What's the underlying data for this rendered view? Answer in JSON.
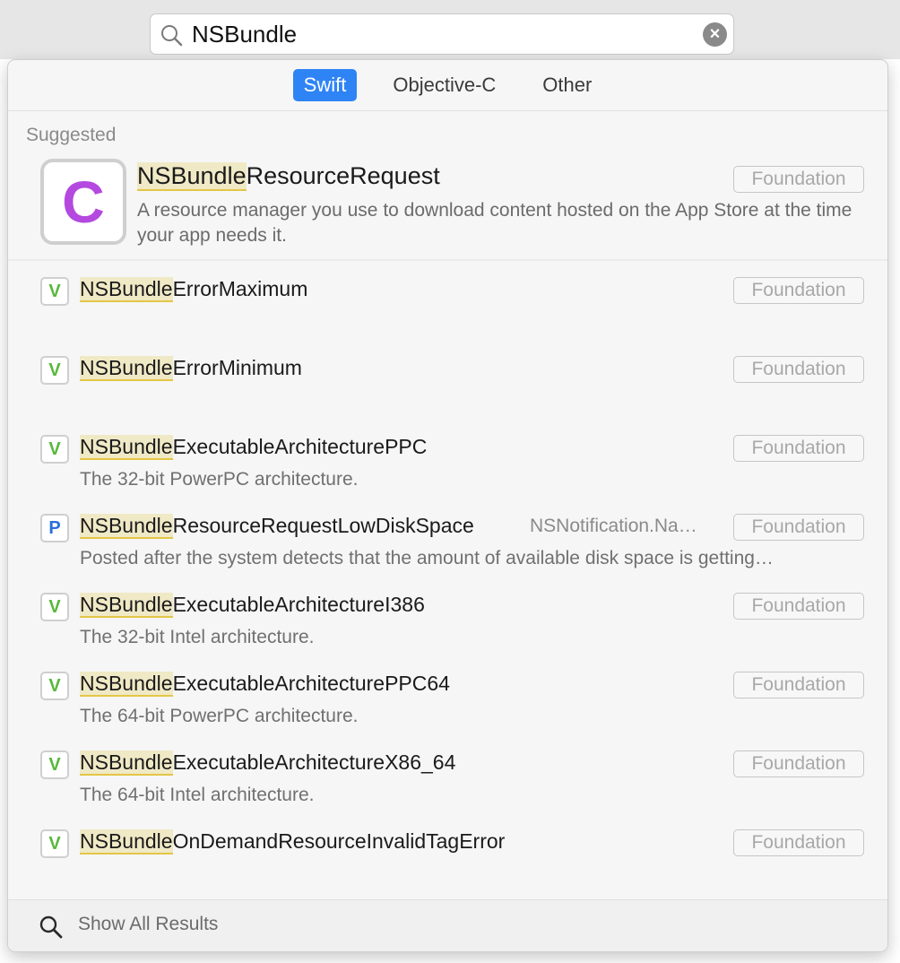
{
  "search": {
    "query": "NSBundle",
    "clear_icon": "clear-icon",
    "search_icon": "search-icon"
  },
  "tabs": [
    {
      "label": "Swift",
      "active": true
    },
    {
      "label": "Objective-C",
      "active": false
    },
    {
      "label": "Other",
      "active": false
    }
  ],
  "section_label": "Suggested",
  "suggested": {
    "icon_letter": "C",
    "title_match": "NSBundle",
    "title_rest": "ResourceRequest",
    "badge": "Foundation",
    "description": "A resource manager you use to download content hosted on the App Store at the time your app needs it."
  },
  "results": [
    {
      "kind": "V",
      "title_match": "NSBundle",
      "title_rest": "ErrorMaximum",
      "extra": "",
      "subtitle": "",
      "badge": "Foundation"
    },
    {
      "kind": "V",
      "title_match": "NSBundle",
      "title_rest": "ErrorMinimum",
      "extra": "",
      "subtitle": "",
      "badge": "Foundation"
    },
    {
      "kind": "V",
      "title_match": "NSBundle",
      "title_rest": "ExecutableArchitecturePPC",
      "extra": "",
      "subtitle": "The 32-bit PowerPC architecture.",
      "badge": "Foundation"
    },
    {
      "kind": "P",
      "title_match": "NSBundle",
      "title_rest": "ResourceRequestLowDiskSpace",
      "extra": "NSNotification.Na…",
      "subtitle": "Posted after the system detects that the amount of available disk space is getting…",
      "badge": "Foundation"
    },
    {
      "kind": "V",
      "title_match": "NSBundle",
      "title_rest": "ExecutableArchitectureI386",
      "extra": "",
      "subtitle": "The 32-bit Intel architecture.",
      "badge": "Foundation"
    },
    {
      "kind": "V",
      "title_match": "NSBundle",
      "title_rest": "ExecutableArchitecturePPC64",
      "extra": "",
      "subtitle": "The 64-bit PowerPC architecture.",
      "badge": "Foundation"
    },
    {
      "kind": "V",
      "title_match": "NSBundle",
      "title_rest": "ExecutableArchitectureX86_64",
      "extra": "",
      "subtitle": "The 64-bit Intel architecture.",
      "badge": "Foundation"
    },
    {
      "kind": "V",
      "title_match": "NSBundle",
      "title_rest": "OnDemandResourceInvalidTagError",
      "extra": "",
      "subtitle": "",
      "badge": "Foundation"
    }
  ],
  "footer": {
    "label": "Show All Results"
  },
  "colors": {
    "accent": "#2f84f5",
    "class_icon": "#b449e0",
    "variable_icon": "#58b83a",
    "property_icon": "#2a6ed8",
    "highlight": "#f0e9c6"
  }
}
